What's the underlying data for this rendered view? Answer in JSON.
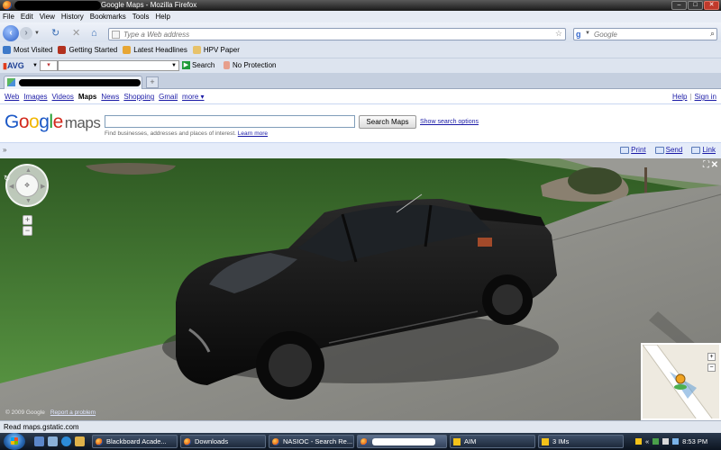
{
  "window": {
    "title": "Google Maps - Mozilla Firefox",
    "buttons": {
      "minimize": "–",
      "maximize": "□",
      "close": "✕"
    }
  },
  "menubar": [
    "File",
    "Edit",
    "View",
    "History",
    "Bookmarks",
    "Tools",
    "Help"
  ],
  "navbar": {
    "address_placeholder": "Type a Web address",
    "search_placeholder": "Google",
    "search_engine_letter": "g"
  },
  "bookmarks": [
    {
      "label": "Most Visited",
      "color": "#3d79c9"
    },
    {
      "label": "Getting Started",
      "color": "#b2311f"
    },
    {
      "label": "Latest Headlines",
      "color": "#e7a634"
    },
    {
      "label": "HPV Paper",
      "color": "#e7c26a"
    }
  ],
  "avg_toolbar": {
    "logo": "AVG",
    "search_label": "Search",
    "protection_label": "No Protection"
  },
  "tabs": {
    "new_tab_symbol": "+"
  },
  "google_bar": {
    "links": [
      "Web",
      "Images",
      "Videos",
      "Maps",
      "News",
      "Shopping",
      "Gmail",
      "more ▾"
    ],
    "current": "Maps",
    "right_links": [
      "Help",
      "Sign in"
    ],
    "separator": "|"
  },
  "maps_header": {
    "logo_letters": [
      {
        "ch": "G",
        "color": "#1b58c6"
      },
      {
        "ch": "o",
        "color": "#d2291c"
      },
      {
        "ch": "o",
        "color": "#f2b600"
      },
      {
        "ch": "g",
        "color": "#1b58c6"
      },
      {
        "ch": "l",
        "color": "#1a9a2a"
      },
      {
        "ch": "e",
        "color": "#d2291c"
      }
    ],
    "logo_suffix": "maps",
    "search_button": "Search Maps",
    "show_options": "Show search options",
    "hint": "Find businesses, addresses and places of interest.",
    "learn_more": "Learn more"
  },
  "options_bar": {
    "collapse": "»",
    "actions": [
      "Print",
      "Send",
      "Link"
    ]
  },
  "street_view": {
    "zoom_in": "+",
    "zoom_out": "−",
    "fullscreen": "⛶",
    "close": "✕",
    "copyright": "© 2009 Google",
    "report": "Report a problem",
    "minimap": {
      "zoom_in": "+",
      "zoom_out": "−"
    }
  },
  "status": "Read maps.gstatic.com",
  "taskbar": {
    "tasks": [
      {
        "label": "Blackboard Acade...",
        "icon": "firefox"
      },
      {
        "label": "Downloads",
        "icon": "firefox"
      },
      {
        "label": "NASIOC - Search Re...",
        "icon": "firefox"
      },
      {
        "label": "",
        "icon": "firefox",
        "redacted": true
      },
      {
        "label": "AIM",
        "icon": "aim"
      },
      {
        "label": "3 IMs",
        "icon": "aim"
      }
    ],
    "clock": "8:53 PM"
  },
  "colors": {
    "google_link": "#1a1aa6",
    "google_bar_bg": "#e5ecf9",
    "lawn": "#4f8a3c",
    "driveway": "#8f8f8a",
    "car": "#141414"
  }
}
